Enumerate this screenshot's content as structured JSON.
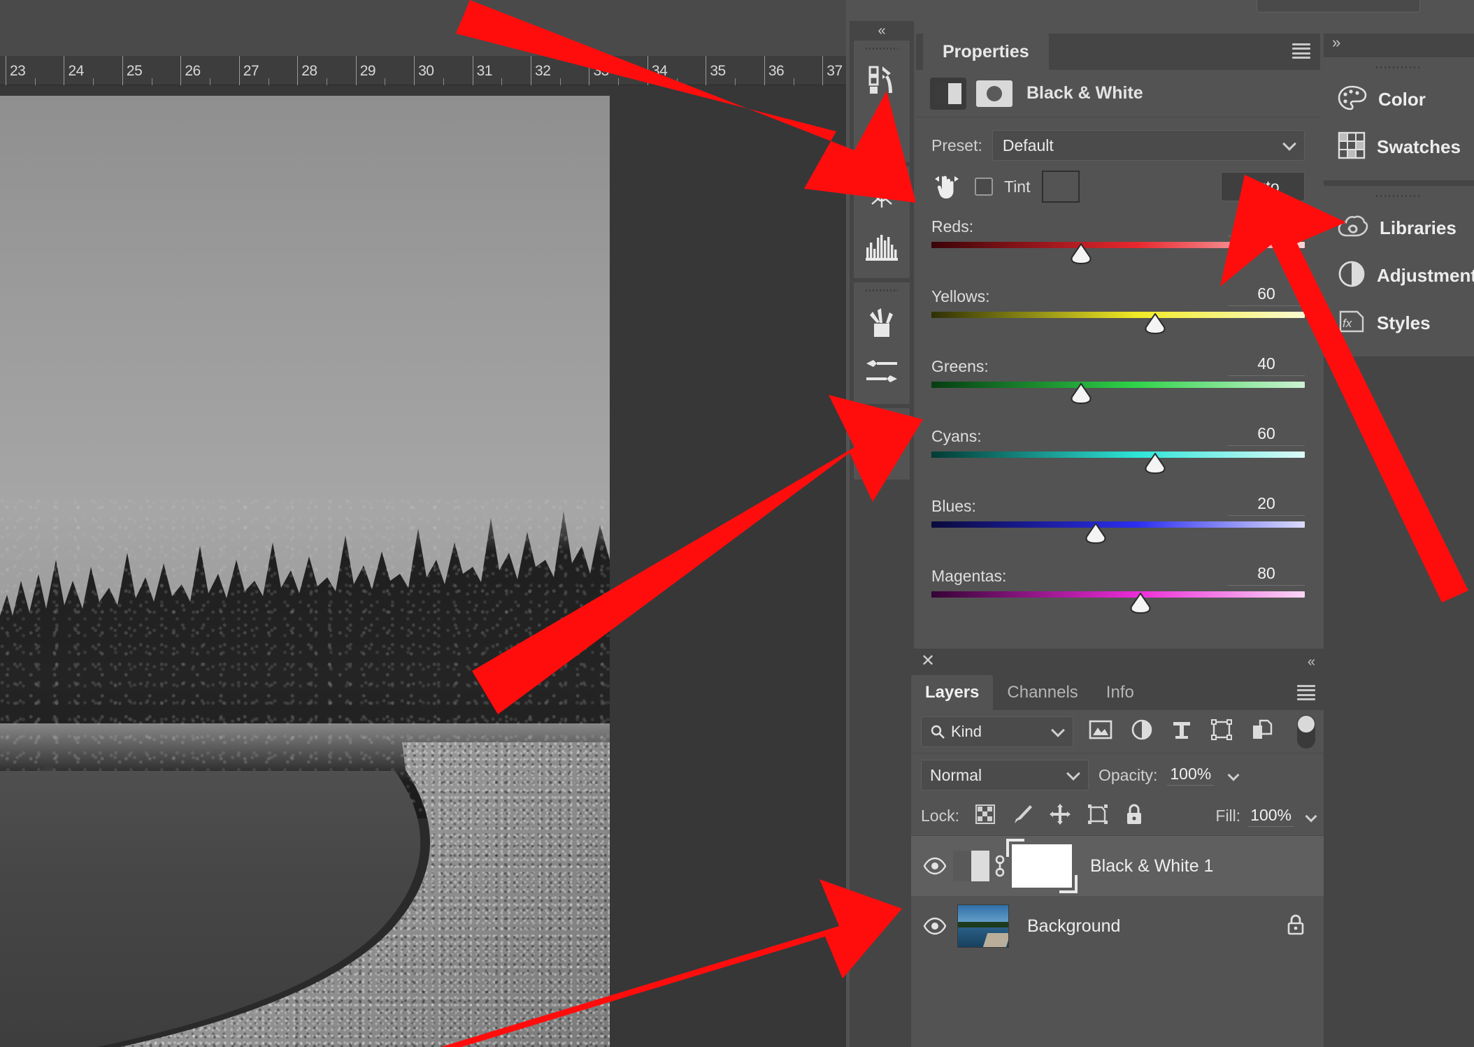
{
  "app": "Adobe Photoshop",
  "canvas": {
    "ruler_unit_labels": [
      "23",
      "24",
      "25",
      "26",
      "27",
      "28",
      "29",
      "30",
      "31",
      "32",
      "33",
      "34",
      "35",
      "36",
      "37"
    ],
    "document_description": "Black and white landscape photo of a lake shoreline with pine forest"
  },
  "icon_dock": {
    "collapse_label": "«",
    "groups": [
      {
        "icons": [
          "actions-icon",
          "play-icon"
        ]
      },
      {
        "icons": [
          "timeline-icon",
          "histogram-icon"
        ]
      },
      {
        "icons": [
          "brush-presets-icon",
          "brush-settings-icon"
        ]
      },
      {
        "icons": [
          "clone-source-icon"
        ]
      }
    ]
  },
  "properties": {
    "tab_label": "Properties",
    "menu_icon": "panel-menu-icon",
    "adjustment_icon": "black-white-adjustment-icon",
    "mask_icon": "layer-mask-icon",
    "title": "Black & White",
    "preset_label": "Preset:",
    "preset_value": "Default",
    "preset_chevron": "chevron-down-icon",
    "targeted_adjustment_icon": "targeted-adjustment-hand-icon",
    "tint_label": "Tint",
    "tint_checked": false,
    "auto_label": "Auto",
    "sliders": [
      {
        "name": "Reds:",
        "value": "40",
        "pct": 40,
        "from": "#3a0408",
        "mid": "#e8282e",
        "to": "#fad4d6"
      },
      {
        "name": "Yellows:",
        "value": "60",
        "pct": 60,
        "from": "#2f3005",
        "mid": "#f0ea26",
        "to": "#fbfbd2"
      },
      {
        "name": "Greens:",
        "value": "40",
        "pct": 40,
        "from": "#063d12",
        "mid": "#2fd44a",
        "to": "#cdf2d4"
      },
      {
        "name": "Cyans:",
        "value": "60",
        "pct": 60,
        "from": "#023b34",
        "mid": "#2ee4d8",
        "to": "#ddfaf7"
      },
      {
        "name": "Blues:",
        "value": "20",
        "pct": 44,
        "from": "#0a0a3c",
        "mid": "#2b2ef0",
        "to": "#dcdcfa"
      },
      {
        "name": "Magentas:",
        "value": "80",
        "pct": 56,
        "from": "#350435",
        "mid": "#ec2bd8",
        "to": "#f9d7f5"
      }
    ]
  },
  "layers_panel": {
    "close_icon": "close-icon",
    "collapse_icon": "collapse-arrows-icon",
    "menu_icon": "panel-menu-icon",
    "tabs": [
      {
        "label": "Layers",
        "active": true
      },
      {
        "label": "Channels",
        "active": false
      },
      {
        "label": "Info",
        "active": false
      }
    ],
    "filter": {
      "search_icon": "search-icon",
      "kind_label": "Kind",
      "chevron": "chevron-down-icon",
      "filter_icons": [
        "pixel-layer-filter-icon",
        "adjustment-layer-filter-icon",
        "type-layer-filter-icon",
        "shape-layer-filter-icon",
        "smart-object-filter-icon"
      ],
      "toggle_icon": "filter-toggle-icon"
    },
    "blend": {
      "mode": "Normal",
      "chevron": "chevron-down-icon",
      "opacity_label": "Opacity:",
      "opacity_value": "100%",
      "opacity_chevron": "chevron-down-icon"
    },
    "lock": {
      "label": "Lock:",
      "icons": [
        "lock-transparent-pixels-icon",
        "lock-image-pixels-icon",
        "lock-position-icon",
        "lock-artboard-icon",
        "lock-all-icon"
      ],
      "fill_label": "Fill:",
      "fill_value": "100%",
      "fill_chevron": "chevron-down-icon"
    },
    "layers": [
      {
        "name": "Black & White 1",
        "visible": true,
        "selected": true,
        "thumb_type": "black-white-adjustment-thumb",
        "has_link": true,
        "has_mask": true,
        "locked": false
      },
      {
        "name": "Background",
        "visible": true,
        "selected": false,
        "thumb_type": "photo-thumb",
        "has_link": false,
        "has_mask": false,
        "locked": true
      }
    ]
  },
  "right_rail": {
    "collapse_label": "»",
    "groups": [
      {
        "items": [
          {
            "label": "Color",
            "icon": "color-palette-icon"
          },
          {
            "label": "Swatches",
            "icon": "swatches-grid-icon"
          }
        ]
      },
      {
        "items": [
          {
            "label": "Libraries",
            "icon": "creative-cloud-libraries-icon"
          },
          {
            "label": "Adjustments",
            "icon": "adjustments-half-circle-icon"
          },
          {
            "label": "Styles",
            "icon": "styles-fx-icon"
          }
        ]
      }
    ]
  },
  "annotations": {
    "arrow_color": "#FF0D0D",
    "arrows": [
      {
        "name": "arrow-to-properties-panel"
      },
      {
        "name": "arrow-to-sliders"
      },
      {
        "name": "arrow-to-adjustments-rail"
      },
      {
        "name": "arrow-to-layers-list"
      }
    ]
  }
}
